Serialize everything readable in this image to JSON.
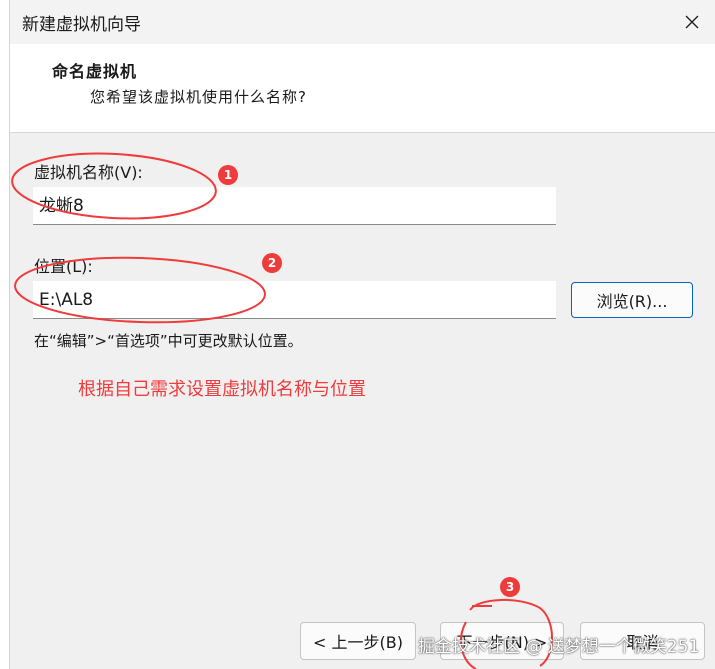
{
  "window": {
    "title": "新建虚拟机向导",
    "close_icon": "close-icon"
  },
  "header": {
    "title": "命名虚拟机",
    "subtitle": "您希望该虚拟机使用什么名称?"
  },
  "form": {
    "name_label": "虚拟机名称(V):",
    "name_value": "龙蜥8",
    "location_label": "位置(L):",
    "location_value": "E:\\AL8",
    "browse_label": "浏览(R)...",
    "hint": "在“编辑”>“首选项”中可更改默认位置。"
  },
  "annotation": {
    "text": "根据自己需求设置虚拟机名称与位置",
    "badges": [
      "1",
      "2",
      "3"
    ],
    "color": "#f03b3b"
  },
  "footer": {
    "back_label": "< 上一步(B)",
    "next_label": "下一步(N) >",
    "cancel_label": "取消"
  },
  "watermark": "掘金技术社区 @ 送梦想一个微笑251"
}
